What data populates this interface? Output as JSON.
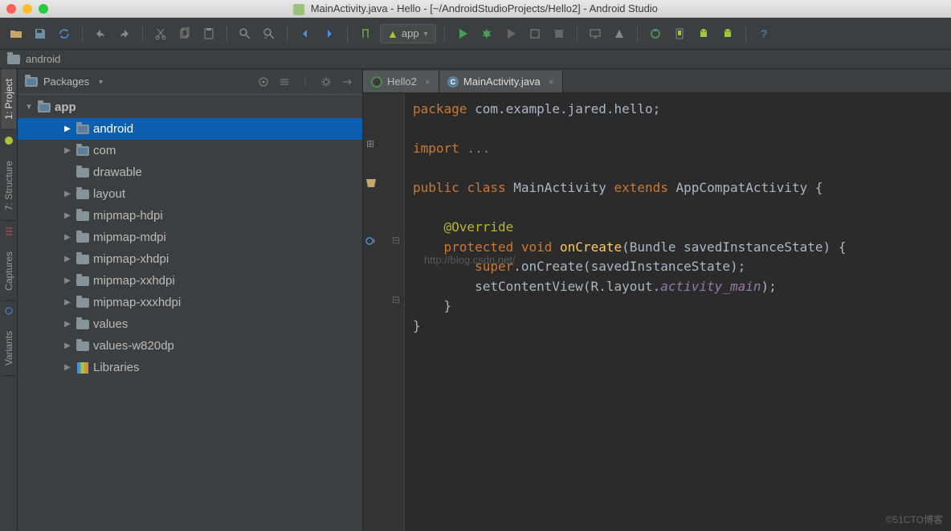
{
  "window": {
    "title": "MainActivity.java - Hello - [~/AndroidStudioProjects/Hello2] - Android Studio"
  },
  "toolbar": {
    "run_config": "app"
  },
  "breadcrumb": {
    "item": "android"
  },
  "project_panel": {
    "title": "Packages",
    "tree": {
      "root": "app",
      "items": [
        {
          "label": "android",
          "indent": 2,
          "icon": "pkg",
          "arrow": "▶",
          "selected": true
        },
        {
          "label": "com",
          "indent": 2,
          "icon": "pkg",
          "arrow": "▶"
        },
        {
          "label": "drawable",
          "indent": 2,
          "icon": "folder",
          "arrow": ""
        },
        {
          "label": "layout",
          "indent": 2,
          "icon": "folder",
          "arrow": "▶"
        },
        {
          "label": "mipmap-hdpi",
          "indent": 2,
          "icon": "folder",
          "arrow": "▶"
        },
        {
          "label": "mipmap-mdpi",
          "indent": 2,
          "icon": "folder",
          "arrow": "▶"
        },
        {
          "label": "mipmap-xhdpi",
          "indent": 2,
          "icon": "folder",
          "arrow": "▶"
        },
        {
          "label": "mipmap-xxhdpi",
          "indent": 2,
          "icon": "folder",
          "arrow": "▶"
        },
        {
          "label": "mipmap-xxxhdpi",
          "indent": 2,
          "icon": "folder",
          "arrow": "▶"
        },
        {
          "label": "values",
          "indent": 2,
          "icon": "folder",
          "arrow": "▶"
        },
        {
          "label": "values-w820dp",
          "indent": 2,
          "icon": "folder",
          "arrow": "▶"
        },
        {
          "label": "Libraries",
          "indent": 2,
          "icon": "lib",
          "arrow": "▶"
        }
      ]
    }
  },
  "left_tabs": {
    "project": "1: Project",
    "structure": "7: Structure",
    "captures": "Captures",
    "variants": "Variants"
  },
  "editor": {
    "tabs": [
      {
        "label": "Hello2",
        "icon": "gradle",
        "active": false
      },
      {
        "label": "MainActivity.java",
        "icon": "java",
        "active": true
      }
    ],
    "code": {
      "l1_kw": "package",
      "l1_rest": " com.example.jared.hello;",
      "l3_kw": "import",
      "l3_rest": " ...",
      "l5_kw1": "public ",
      "l5_kw2": "class ",
      "l5_cls": "MainActivity ",
      "l5_kw3": "extends ",
      "l5_sup": "AppCompatActivity {",
      "l7_ann": "@Override",
      "l8_kw1": "protected ",
      "l8_kw2": "void ",
      "l8_fn": "onCreate",
      "l8_rest": "(Bundle savedInstanceState) {",
      "l9_kw": "super",
      "l9_rest": ".onCreate(savedInstanceState);",
      "l10_a": "setContentView(R.layout.",
      "l10_b": "activity_main",
      "l10_c": ");",
      "l11": "}",
      "l12": "}"
    },
    "watermark": "http://blog.csdn.net/"
  },
  "footer_watermark": "©51CTO博客"
}
